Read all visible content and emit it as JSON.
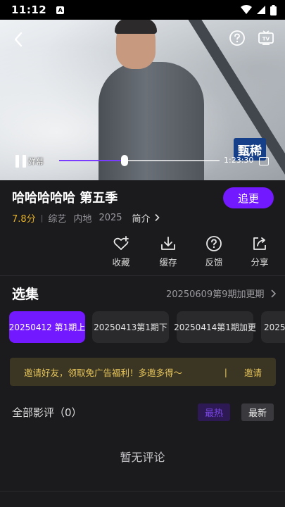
{
  "status_bar": {
    "time": "11:12",
    "app_icon_letter": "A"
  },
  "player": {
    "danmu_label": "弹幕",
    "logo_text": "甄稀",
    "time_text": "1:23:30",
    "progress": 0.41
  },
  "show": {
    "title": "哈哈哈哈哈 第五季",
    "score": "7.8分",
    "category": "综艺",
    "region": "内地",
    "year": "2025",
    "intro_label": "简介"
  },
  "follow_label": "追更",
  "actions": [
    {
      "label": "收藏",
      "icon": "heart-plus-icon"
    },
    {
      "label": "缓存",
      "icon": "download-icon"
    },
    {
      "label": "反馈",
      "icon": "question-icon"
    },
    {
      "label": "分享",
      "icon": "share-icon"
    }
  ],
  "episodes": {
    "title": "选集",
    "update_info": "20250609第9期加更期",
    "items": [
      {
        "label": "20250412 第1期上",
        "active": true
      },
      {
        "label": "20250413第1期下",
        "active": false
      },
      {
        "label": "20250414第1期加更",
        "active": false
      },
      {
        "label": "2025",
        "active": false
      }
    ]
  },
  "invite": {
    "text": "邀请好友，领取免广告福利！多邀多得～",
    "separator": "|",
    "button": "邀请"
  },
  "comments": {
    "title": "全部影评（0）",
    "tab_hot": "最热",
    "tab_new": "最新",
    "empty": "暂无评论"
  },
  "colors": {
    "accent": "#7319ff",
    "background": "#1b1b1d",
    "score": "#e6b22a",
    "invite_text": "#e7c65a"
  }
}
